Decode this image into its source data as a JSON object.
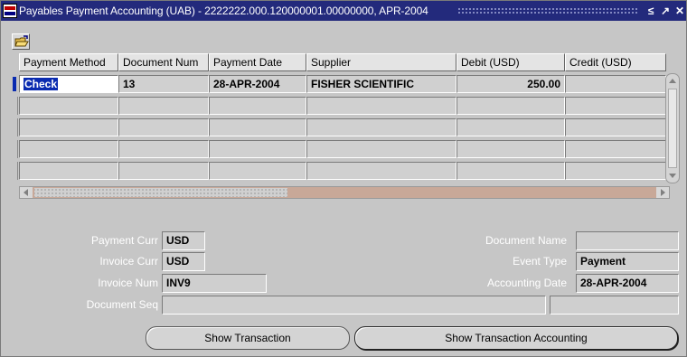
{
  "window": {
    "title": "Payables Payment Accounting (UAB) - 2222222.000.120000001.00000000, APR-2004",
    "controls": [
      "≤",
      "↗",
      "✕"
    ]
  },
  "table": {
    "columns": [
      "Payment Method",
      "Document Num",
      "Payment Date",
      "Supplier",
      "Debit (USD)",
      "Credit (USD)"
    ],
    "rows": [
      {
        "payment_method": "Check",
        "document_num": "13",
        "payment_date": "28-APR-2004",
        "supplier": "FISHER SCIENTIFIC",
        "debit": "250.00",
        "credit": ""
      },
      {
        "payment_method": "",
        "document_num": "",
        "payment_date": "",
        "supplier": "",
        "debit": "",
        "credit": ""
      },
      {
        "payment_method": "",
        "document_num": "",
        "payment_date": "",
        "supplier": "",
        "debit": "",
        "credit": ""
      },
      {
        "payment_method": "",
        "document_num": "",
        "payment_date": "",
        "supplier": "",
        "debit": "",
        "credit": ""
      },
      {
        "payment_method": "",
        "document_num": "",
        "payment_date": "",
        "supplier": "",
        "debit": "",
        "credit": ""
      }
    ]
  },
  "details": {
    "payment_curr_label": "Payment Curr",
    "payment_curr": "USD",
    "invoice_curr_label": "Invoice Curr",
    "invoice_curr": "USD",
    "invoice_num_label": "Invoice Num",
    "invoice_num": "INV9",
    "document_seq_label": "Document Seq",
    "document_seq": "",
    "document_name_label": "Document Name",
    "document_name": "",
    "event_type_label": "Event Type",
    "event_type": "Payment",
    "accounting_date_label": "Accounting Date",
    "accounting_date": "28-APR-2004"
  },
  "buttons": {
    "show_transaction": "Show Transaction",
    "show_transaction_accounting": "Show Transaction Accounting"
  },
  "icons": {
    "toolbar_open": "open-folder-icon"
  },
  "colors": {
    "titlebar": "#232a7c",
    "selection": "#0a2bb0",
    "background": "#c6c6c6"
  }
}
